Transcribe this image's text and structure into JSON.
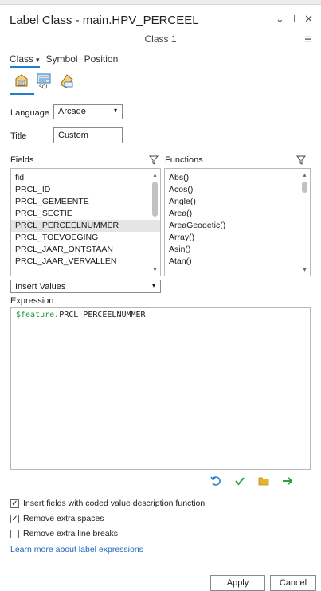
{
  "window": {
    "title": "Label Class - main.HPV_PERCEEL",
    "subtitle": "Class 1",
    "controls": [
      "chevron-down-icon",
      "pin-icon",
      "close-icon"
    ]
  },
  "tabs": [
    {
      "label": "Class",
      "active": true,
      "has_dropdown": true
    },
    {
      "label": "Symbol",
      "active": false
    },
    {
      "label": "Position",
      "active": false
    }
  ],
  "tool_icons": [
    "label-expression-icon",
    "sql-query-icon",
    "label-filter-icon"
  ],
  "language": {
    "label": "Language",
    "value": "Arcade"
  },
  "title_field": {
    "label": "Title",
    "value": "Custom"
  },
  "fields": {
    "label": "Fields",
    "items": [
      "fid",
      "PRCL_ID",
      "PRCL_GEMEENTE",
      "PRCL_SECTIE",
      "PRCL_PERCEELNUMMER",
      "PRCL_TOEVOEGING",
      "PRCL_JAAR_ONTSTAAN",
      "PRCL_JAAR_VERVALLEN"
    ],
    "selected_index": 4
  },
  "functions": {
    "label": "Functions",
    "items": [
      "Abs()",
      "Acos()",
      "Angle()",
      "Area()",
      "AreaGeodetic()",
      "Array()",
      "Asin()",
      "Atan()"
    ]
  },
  "insert_values": {
    "value": "Insert Values"
  },
  "expression": {
    "label": "Expression",
    "var": "$feature",
    "rest": ".PRCL_PERCEELNUMMER"
  },
  "expression_actions": [
    {
      "icon": "undo-icon",
      "color": "#1f7fd1"
    },
    {
      "icon": "verify-check-icon",
      "color": "#2e9e3b"
    },
    {
      "icon": "open-folder-icon",
      "color": "#e8b42a"
    },
    {
      "icon": "arrow-right-icon",
      "color": "#2e9e3b"
    }
  ],
  "options": [
    {
      "label": "Insert fields with coded value description function",
      "checked": true
    },
    {
      "label": "Remove extra spaces",
      "checked": true
    },
    {
      "label": "Remove extra line breaks",
      "checked": false
    }
  ],
  "learn_more": "Learn more about label expressions",
  "buttons": {
    "apply": "Apply",
    "cancel": "Cancel"
  },
  "colors": {
    "accent": "#1f7fd1",
    "link": "#1f66c1",
    "arcade_var": "#1a9a3b"
  }
}
